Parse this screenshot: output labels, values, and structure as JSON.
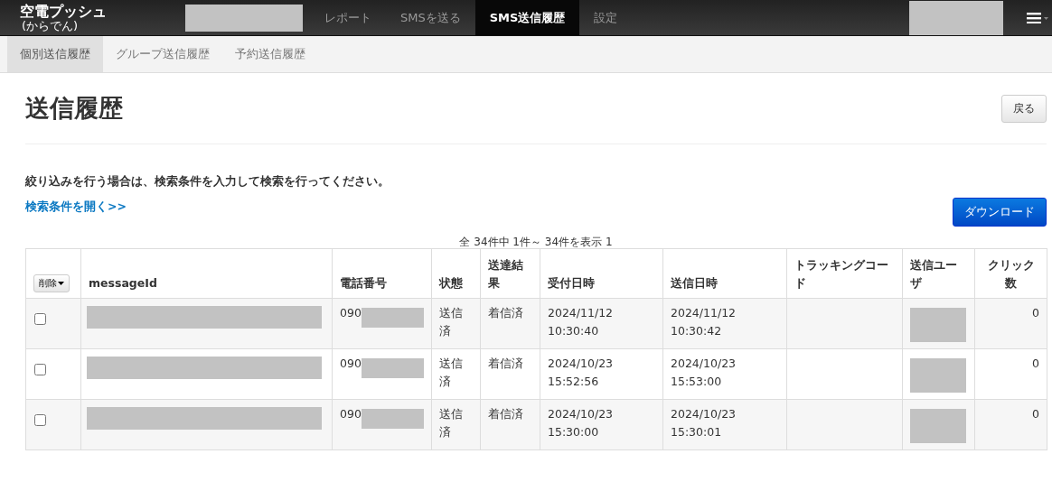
{
  "navbar": {
    "logo": "空電プッシュ",
    "logo_sub": "(からでん)",
    "items": [
      {
        "label": "レポート",
        "selected": false
      },
      {
        "label": "SMSを送る",
        "selected": false
      },
      {
        "label": "SMS送信履歴",
        "selected": true
      },
      {
        "label": "設定",
        "selected": false
      }
    ]
  },
  "subnav": [
    {
      "label": "個別送信履歴",
      "selected": true
    },
    {
      "label": "グループ送信履歴",
      "selected": false
    },
    {
      "label": "予約送信履歴",
      "selected": false
    }
  ],
  "page": {
    "title": "送信履歴",
    "back_button": "戻る",
    "instruction": "絞り込みを行う場合は、検索条件を入力して検索を行ってください。",
    "search_link": "検索条件を開く>>",
    "download_button": "ダウンロード",
    "pagination": "全 34件中  1件～ 34件を表示  1"
  },
  "table": {
    "delete_button": "削除",
    "columns": [
      "messageId",
      "電話番号",
      "状態",
      "送達結果",
      "受付日時",
      "送信日時",
      "トラッキングコード",
      "送信ユーザ",
      "クリック数"
    ],
    "rows": [
      {
        "checked": false,
        "phone": "090",
        "status": "送信済",
        "result": "着信済",
        "received": "2024/11/12 10:30:40",
        "sent": "2024/11/12 10:30:42",
        "clicks": "0"
      },
      {
        "checked": false,
        "phone": "090",
        "status": "送信済",
        "result": "着信済",
        "received": "2024/10/23 15:52:56",
        "sent": "2024/10/23 15:53:00",
        "clicks": "0"
      },
      {
        "checked": false,
        "phone": "090",
        "status": "送信済",
        "result": "着信済",
        "received": "2024/10/23 15:30:00",
        "sent": "2024/10/23 15:30:01",
        "clicks": "0"
      }
    ]
  }
}
